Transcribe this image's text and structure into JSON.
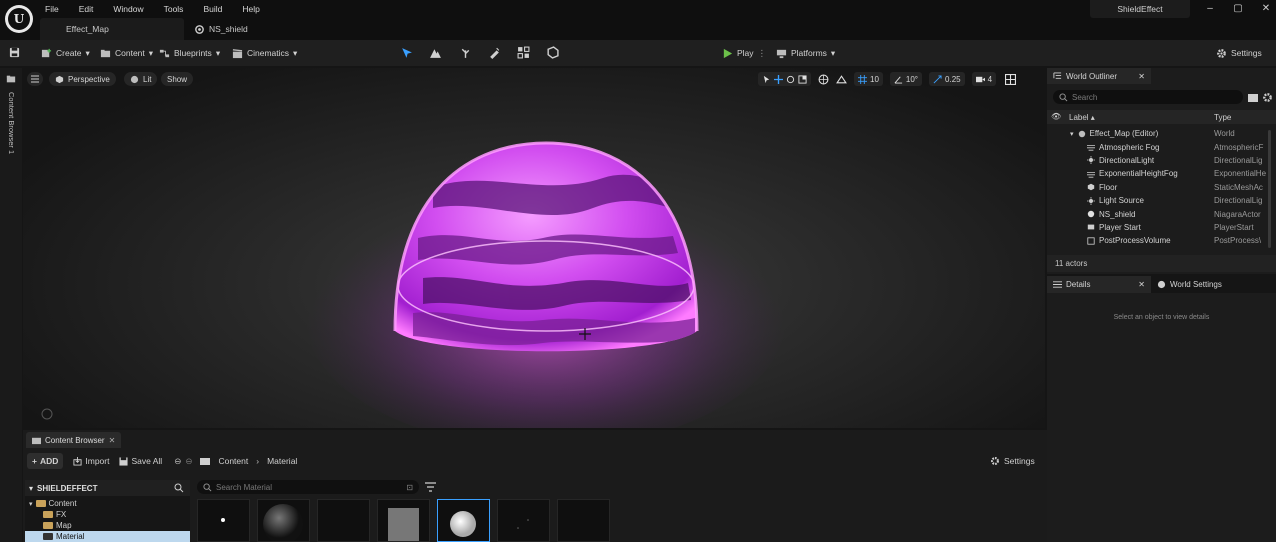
{
  "menu": [
    "File",
    "Edit",
    "Window",
    "Tools",
    "Build",
    "Help"
  ],
  "tabs": {
    "map": "Effect_Map",
    "asset": "NS_shield"
  },
  "project_name": "ShieldEffect",
  "window_controls": {
    "minimize": "–",
    "maximize": "▢",
    "close": "✕"
  },
  "toolbar": {
    "create": "Create",
    "content": "Content",
    "blueprints": "Blueprints",
    "cinematics": "Cinematics",
    "play": "Play",
    "platforms": "Platforms",
    "settings": "Settings"
  },
  "left_strip": {
    "label": "Content Browser 1"
  },
  "viewport": {
    "perspective": "Perspective",
    "lit": "Lit",
    "show": "Show",
    "grid_snap": "10",
    "rotation_snap": "10°",
    "scale_snap": "0.25",
    "camera_speed": "4",
    "dome_color": "#c040e8"
  },
  "content_browser": {
    "tab": "Content Browser",
    "add": "ADD",
    "import": "Import",
    "save_all": "Save All",
    "path": [
      "Content",
      "Material"
    ],
    "settings": "Settings",
    "tree_root": "SHIELDEFFECT",
    "tree": [
      "Content",
      "FX",
      "Map",
      "Material"
    ],
    "search_placeholder": "Search Material"
  },
  "outliner": {
    "tab": "World Outliner",
    "search_placeholder": "Search",
    "col_label": "Label",
    "col_type": "Type",
    "rows": [
      {
        "label": "Effect_Map (Editor)",
        "type": "World",
        "icon": "world-icon"
      },
      {
        "label": "Atmospheric Fog",
        "type": "AtmosphericF",
        "icon": "fog-icon"
      },
      {
        "label": "DirectionalLight",
        "type": "DirectionalLig",
        "icon": "light-icon"
      },
      {
        "label": "ExponentialHeightFog",
        "type": "ExponentialHe",
        "icon": "fog-icon"
      },
      {
        "label": "Floor",
        "type": "StaticMeshAc",
        "icon": "mesh-icon"
      },
      {
        "label": "Light Source",
        "type": "DirectionalLig",
        "icon": "light-icon"
      },
      {
        "label": "NS_shield",
        "type": "NiagaraActor",
        "icon": "niagara-icon"
      },
      {
        "label": "Player Start",
        "type": "PlayerStart",
        "icon": "player-icon"
      },
      {
        "label": "PostProcessVolume",
        "type": "PostProcess\\",
        "icon": "volume-icon"
      }
    ],
    "count": "11 actors"
  },
  "details": {
    "tab": "Details",
    "world_settings": "World Settings",
    "empty": "Select an object to view details"
  }
}
